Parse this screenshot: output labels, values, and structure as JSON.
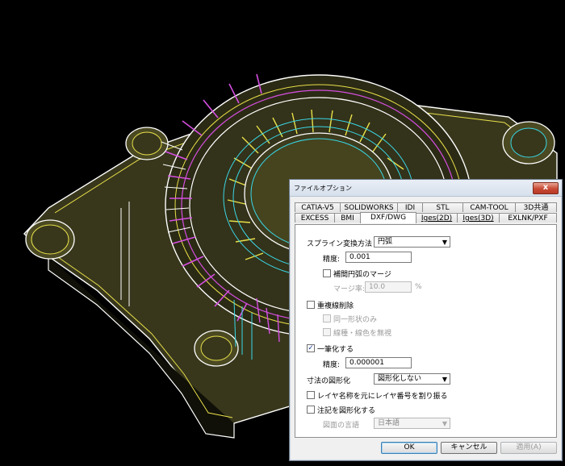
{
  "dialog": {
    "title": "ファイルオプション",
    "close_label": "x"
  },
  "tabs": {
    "row1": [
      "CATIA-V5",
      "SOLIDWORKS",
      "IDI",
      "STL",
      "CAM-TOOL",
      "3D共通"
    ],
    "row2": [
      "EXCESS",
      "BMI",
      "DXF/DWG",
      "Iges(2D)",
      "Iges(3D)",
      "EXLNK/PXF"
    ],
    "active": "DXF/DWG"
  },
  "form": {
    "spline_label": "スプライン変換方法",
    "spline_value": "円弧",
    "precision_label": "精度:",
    "precision_value": "0.001",
    "arc_merge_label": "補間円弧のマージ",
    "arc_merge_checked": false,
    "merge_rate_label": "マージ率:",
    "merge_rate_value": "10.0",
    "merge_rate_unit": "%",
    "dup_delete_label": "重複線削除",
    "dup_delete_checked": false,
    "same_shape_label": "同一形状のみ",
    "ignore_type_label": "線種・線色を無視",
    "one_stroke_label": "一筆化する",
    "one_stroke_checked": true,
    "one_stroke_precision_label": "精度:",
    "one_stroke_precision_value": "0.000001",
    "dim_label": "寸法の図形化",
    "dim_value": "図形化しない",
    "layer_label": "レイヤ名称を元にレイヤ番号を割り振る",
    "layer_checked": false,
    "annot_label": "注記を図形化する",
    "annot_checked": false,
    "lang_label": "図面の言語",
    "lang_value": "日本語"
  },
  "buttons": {
    "ok": "OK",
    "cancel": "キャンセル",
    "apply": "適用(A)"
  },
  "colors": {
    "viewport_bg": "#000000",
    "part_fill": "#38371c",
    "edge_yellow": "#e8e04a",
    "edge_cyan": "#39d7e6",
    "edge_magenta": "#d54ee0",
    "edge_white": "#ffffff"
  }
}
